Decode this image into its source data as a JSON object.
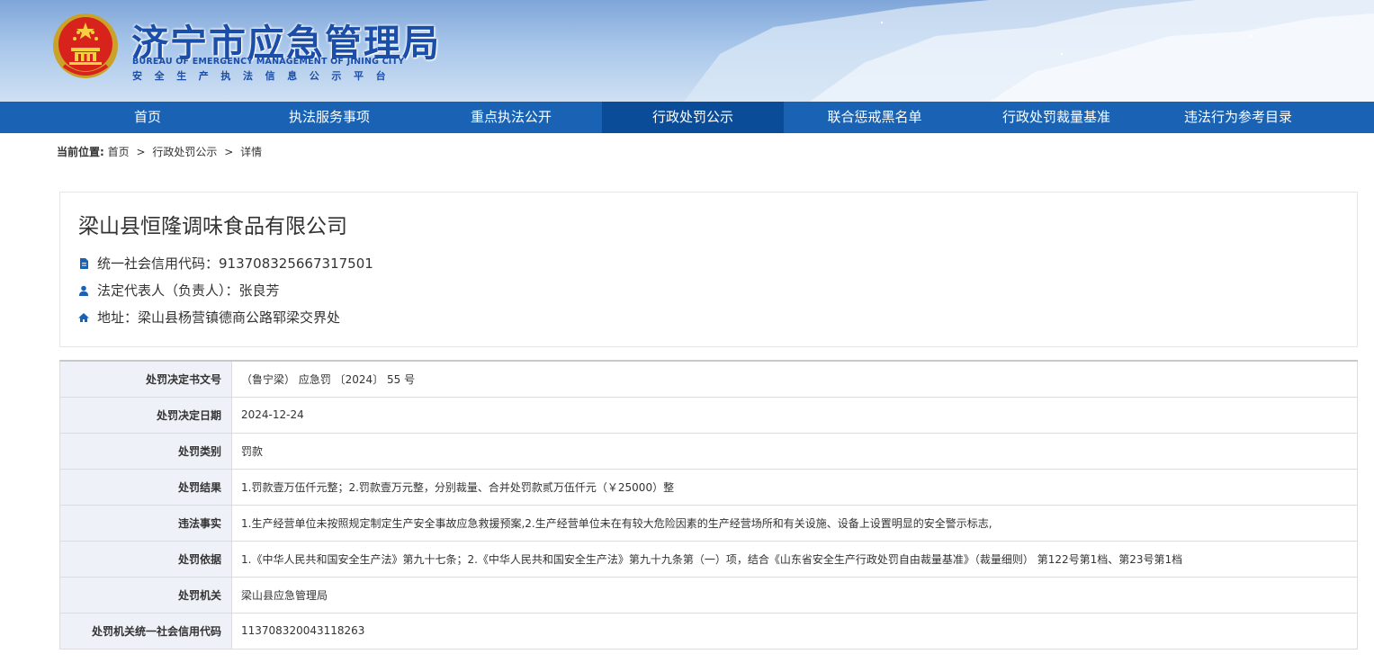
{
  "header": {
    "title": "济宁市应急管理局",
    "title_en": "BUREAU OF EMERGENCY MANAGEMENT OF JINING CITY",
    "subtitle": "安全生产执法信息公示平台"
  },
  "nav": {
    "items": [
      {
        "label": "首页",
        "active": false
      },
      {
        "label": "执法服务事项",
        "active": false
      },
      {
        "label": "重点执法公开",
        "active": false
      },
      {
        "label": "行政处罚公示",
        "active": true
      },
      {
        "label": "联合惩戒黑名单",
        "active": false
      },
      {
        "label": "行政处罚裁量基准",
        "active": false
      },
      {
        "label": "违法行为参考目录",
        "active": false
      }
    ]
  },
  "breadcrumb": {
    "label": "当前位置:",
    "items": [
      "首页",
      "行政处罚公示",
      "详情"
    ],
    "separator": ">"
  },
  "company": {
    "name": "梁山县恒隆调味食品有限公司",
    "credit_code": "统一社会信用代码：913708325667317501",
    "legal_rep": "法定代表人（负责人）：张良芳",
    "address": "地址：梁山县杨营镇德商公路郓梁交界处"
  },
  "table": {
    "rows": [
      {
        "label": "处罚决定书文号",
        "value": "（鲁宁梁） 应急罚 〔2024〕 55 号"
      },
      {
        "label": "处罚决定日期",
        "value": "2024-12-24"
      },
      {
        "label": "处罚类别",
        "value": "罚款"
      },
      {
        "label": "处罚结果",
        "value": "1.罚款壹万伍仟元整；2.罚款壹万元整，分别裁量、合并处罚款贰万伍仟元（￥25000）整"
      },
      {
        "label": "违法事实",
        "value": "1.生产经营单位未按照规定制定生产安全事故应急救援预案,2.生产经营单位未在有较大危险因素的生产经营场所和有关设施、设备上设置明显的安全警示标志,"
      },
      {
        "label": "处罚依据",
        "value": "1.《中华人民共和国安全生产法》第九十七条；2.《中华人民共和国安全生产法》第九十九条第（一）项，结合《山东省安全生产行政处罚自由裁量基准》（裁量细则） 第122号第1档、第23号第1档"
      },
      {
        "label": "处罚机关",
        "value": "梁山县应急管理局"
      },
      {
        "label": "处罚机关统一社会信用代码",
        "value": "113708320043118263"
      }
    ]
  },
  "colors": {
    "nav_bg": "#1a63b4",
    "nav_active": "#0a4c97",
    "title_blue": "#1b4ea8",
    "table_key_bg": "#eef1f7",
    "icon_blue": "#1a63b4"
  }
}
